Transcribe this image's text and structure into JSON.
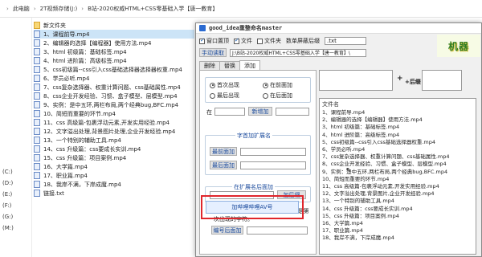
{
  "explorer": {
    "breadcrumbs": [
      "此电脑",
      "2T视频存储(J:)",
      "B站-2020权威HTML+CSS零基础入学【唐一教育】"
    ],
    "sidebar": [
      "(C:)",
      "(D:)",
      "(E:)",
      "(F:)",
      "(G:)",
      "(M:)"
    ],
    "files": [
      {
        "name": "新文件夹",
        "type": "folder"
      },
      {
        "name": "1、课程前导.mp4",
        "type": "file"
      },
      {
        "name": "2、编辑器的选择【编程器】使用方法.mp4",
        "type": "file"
      },
      {
        "name": "3、html 初级篇：基础标签.mp4",
        "type": "file"
      },
      {
        "name": "4、html 进阶篇：高级标签.mp4",
        "type": "file"
      },
      {
        "name": "5、css初级篇--css引入css基础选择器选择器权重.mp4",
        "type": "file"
      },
      {
        "name": "6、学员必听.mp4",
        "type": "file"
      },
      {
        "name": "7、css复杂选择器、权重计算问题、css基础属性.mp4",
        "type": "file"
      },
      {
        "name": "8、css企业开发经验、习惯、盒子模型、层模型.mp4",
        "type": "file"
      },
      {
        "name": "9、实例：是中五环,两栏布局,两个经典bug,BFC.mp4",
        "type": "file"
      },
      {
        "name": "10、简短而重要的环节.mp4",
        "type": "file"
      },
      {
        "name": "11、css 高级篇-包裹浮动元素,开发实用经验.mp4",
        "type": "file"
      },
      {
        "name": "12、文字溢出处理,背景图片处理,企业开发经验.mp4",
        "type": "file"
      },
      {
        "name": "13、一个特别的辅助工具.mp4",
        "type": "file"
      },
      {
        "name": "14、css 升级篇：css要成长实训.mp4",
        "type": "file"
      },
      {
        "name": "15、css 升级篇：项目案例.mp4",
        "type": "file"
      },
      {
        "name": "16、大学篇.mp4",
        "type": "file"
      },
      {
        "name": "17、职业篇.mp4",
        "type": "file"
      },
      {
        "name": "18、我岸不满，下岸成魔.mp4",
        "type": "file"
      },
      {
        "name": "链接.txt",
        "type": "file"
      }
    ]
  },
  "tool": {
    "title": "good_idea重整命名master",
    "options": {
      "window_top": "窗口置顶",
      "file": "文件",
      "folder": "文件夹",
      "shield_ext": "数单屏蔽后缀",
      "ext_value": ".txt"
    },
    "manual_read": "手动读取",
    "path": "J:\\B站-2020权威HTML+CSS零基础入学【唐一教育】\\",
    "banner": "机器",
    "tabs": [
      "删除",
      "替换",
      "添加"
    ],
    "add_panel": {
      "radio_head": "首次出现",
      "radio_tail": "最后出现",
      "radio_before": "在前面加",
      "radio_after": "在后面加",
      "at_label": "在",
      "add_button": "新增加",
      "prefix_group": "字首加扩展名",
      "prefix_add_top": "最前面加",
      "prefix_add_end": "最后面加",
      "ext_group": "在扩展名后面加",
      "ext_add_button": "加后缀",
      "note": "仅用于编号在前面5个字符之内,并且是第一次出现的字符。",
      "number_add_button": "编号后面加",
      "av_button": "加哔哩哔哩AV号"
    },
    "preview": {
      "plus_label": "+",
      "suffix_label": "+后缀",
      "list_header": "文件名",
      "items": [
        "1、课程前导.mp4",
        "2、编辑器的选择【编辑器】使用方法.mp4",
        "3、html 初级篇：基础标签.mp4",
        "4、html 进阶篇：高级标签.mp4",
        "5、css初级篇--css引入css基础选择器权重.mp4",
        "6、学员必听.mp4",
        "7、css复杂选择器、权重计算问题、css基础属性.mp4",
        "8、css企业开发经验、习惯、盒子模型、层模型.mp4",
        "9、实例：是中五环,两栏布局,两个经典bug,BFC.mp4",
        "10、简短而重要的环节.mp4",
        "11、css 高级篇-包裹浮动元素,开发实用经验.mp4",
        "12、文字溢出处理,背景图片,企业开发经验.mp4",
        "13、一个特别的辅助工具.mp4",
        "14、css 升级篇：css要成长实训.mp4",
        "15、css 升级篇：项目案例.mp4",
        "16、大学篇.mp4",
        "17、职业篇.mp4",
        "18、我岸不满，下岸成魔.mp4"
      ]
    }
  },
  "colors": {
    "highlight": "#e0262c",
    "link_text": "#1a4a9c",
    "selection": "#cce4f7"
  }
}
